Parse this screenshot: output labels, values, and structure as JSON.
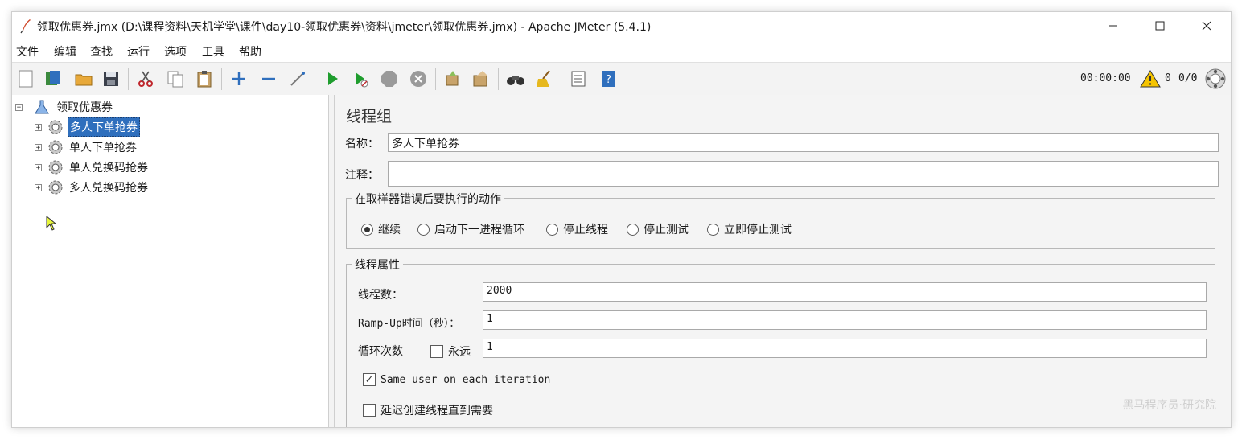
{
  "window": {
    "title": "领取优惠券.jmx (D:\\课程资料\\天机学堂\\课件\\day10-领取优惠券\\资料\\jmeter\\领取优惠券.jmx) - Apache JMeter (5.4.1)",
    "minimize": "—",
    "maximize": "☐",
    "close": "✕"
  },
  "menu": [
    "文件",
    "编辑",
    "查找",
    "运行",
    "选项",
    "工具",
    "帮助"
  ],
  "toolbar": {
    "timer": "00:00:00",
    "warnings": "0",
    "threads": "0/0"
  },
  "tree": {
    "root": "领取优惠券",
    "items": [
      "多人下单抢券",
      "单人下单抢券",
      "单人兑换码抢券",
      "多人兑换码抢券"
    ],
    "selected_index": 0
  },
  "panel": {
    "title": "线程组",
    "name_label": "名称：",
    "name_value": "多人下单抢券",
    "comment_label": "注释：",
    "comment_value": "",
    "error_group": {
      "title": "在取样器错误后要执行的动作",
      "options": [
        "继续",
        "启动下一进程循环",
        "停止线程",
        "停止测试",
        "立即停止测试"
      ],
      "selected_index": 0
    },
    "thread_group": {
      "title": "线程属性",
      "threads_label": "线程数：",
      "threads_value": "2000",
      "rampup_label": "Ramp-Up时间（秒）：",
      "rampup_value": "1",
      "loop_label": "循环次数",
      "forever_label": "永远",
      "forever_checked": false,
      "loop_value": "1",
      "same_user_label": "Same user on each iteration",
      "same_user_checked": true,
      "delay_label": "延迟创建线程直到需要",
      "delay_checked": false
    }
  },
  "watermark": "黑马程序员·研究院"
}
